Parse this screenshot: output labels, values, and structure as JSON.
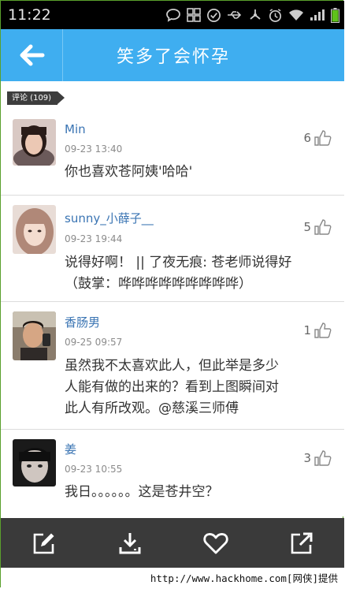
{
  "status_bar": {
    "time": "11:22",
    "icons": [
      "chat-bubble-icon",
      "grid-icon",
      "check-circle-icon",
      "usb-icon",
      "share-icon",
      "alarm-icon",
      "wifi-icon",
      "signal-icon",
      "battery-icon"
    ]
  },
  "header": {
    "back_icon": "arrow-left-icon",
    "title": "笑多了会怀孕",
    "color": "#3faef0"
  },
  "comments_section": {
    "tag": "评论 (109)"
  },
  "comments": [
    {
      "name": "Min",
      "time": "09-23 13:40",
      "likes": "6",
      "text": [
        "你也喜欢苍阿姨'哈哈'"
      ]
    },
    {
      "name": "sunny_小薛子__",
      "time": "09-23 19:44",
      "likes": "5",
      "text": [
        "说得好啊！ || 了夜无痕: 苍老师说得好",
        "（鼓掌：哗哗哗哗哗哗哗哗哗）"
      ]
    },
    {
      "name": "香肠男",
      "time": "09-25 09:57",
      "likes": "1",
      "text": [
        "虽然我不太喜欢此人，但此举是多少",
        "人能有做的出来的？看到上图瞬间对",
        "此人有所改观。@慈溪三师傅"
      ]
    },
    {
      "name": "姜",
      "time": "09-23 10:55",
      "likes": "3",
      "text": [
        "我日。。。。。。这是苍井空？"
      ]
    }
  ],
  "bottom_bar": {
    "buttons": [
      "edit-icon",
      "download-icon",
      "heart-icon",
      "share-out-icon"
    ]
  },
  "watermark": "http://www.hackhome.com[网侠]提供"
}
